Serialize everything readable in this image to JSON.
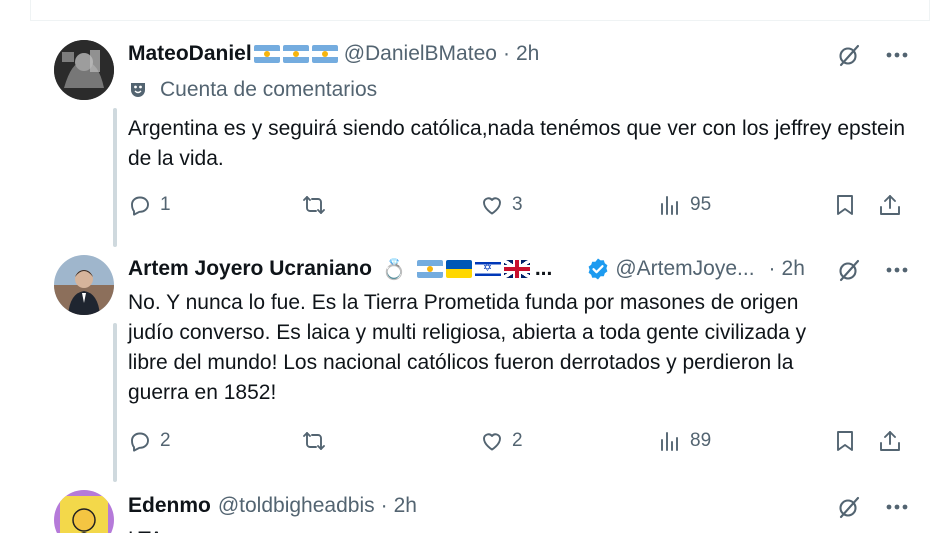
{
  "posts": [
    {
      "name": "MateoDaniel",
      "flags": [
        "ar",
        "ar",
        "ar"
      ],
      "handle": "@DanielBMateo",
      "time": "2h",
      "sub_label": "Cuenta de comentarios",
      "text": "Argentina  es y seguirá siendo católica,nada tenémos que ver con los jeffrey epstein de la vida.",
      "replies": "1",
      "reposts": "",
      "likes": "3",
      "views": "95"
    },
    {
      "name": "Artem Joyero Ucraniano",
      "flags": [
        "ar",
        "ua",
        "il",
        "uk"
      ],
      "flags_ellipsis": "...",
      "handle": "@ArtemJoye...",
      "time": "2h",
      "verified": true,
      "text_lines": [
        "No. Y nunca lo fue. Es la Tierra Prometida funda por masones de origen",
        "judío converso. Es laica y multi religiosa, abierta a toda gente civilizada y",
        "libre del mundo! Los nacional católicos fueron derrotados y perdieron la",
        "guerra en 1852!"
      ],
      "replies": "2",
      "reposts": "",
      "likes": "2",
      "views": "89"
    },
    {
      "name": "Edenmo",
      "handle": "@toldbigheadbis",
      "time": "2h",
      "text": "LTA"
    }
  ],
  "separator": "·",
  "colors": {
    "text_primary": "#0f1419",
    "text_secondary": "#536471",
    "thread_line": "#cfd9de",
    "verified": "#1d9bf0"
  }
}
